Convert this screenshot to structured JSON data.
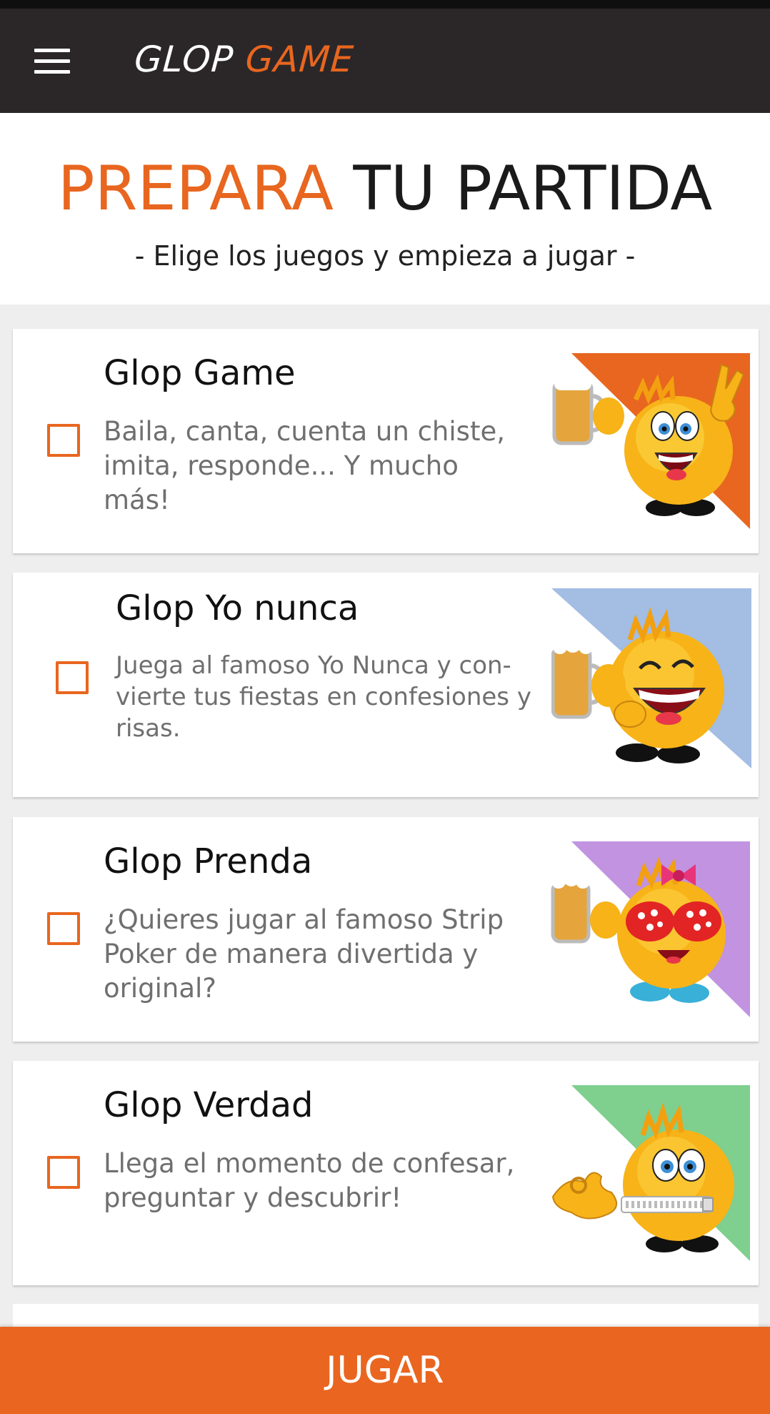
{
  "app": {
    "logo_part1": "GLOP",
    "logo_part2": "GAME",
    "brand_color": "#e8661f",
    "appbar_color": "#2b2729"
  },
  "header": {
    "title_accent": "PREPARA",
    "title_rest": "TU PARTIDA",
    "subtitle": "- Elige los juegos y empieza a jugar -"
  },
  "games": [
    {
      "title": "Glop Game",
      "description": "Baila, canta, cuenta un chiste, imita, responde... Y mucho más!",
      "checked": false,
      "image_color": "#e8661f",
      "mascot": "cheering-mascot-with-beer"
    },
    {
      "title": "Glop Yo nunca",
      "description": "Juega al famoso Yo Nunca y con-vierte tus fiestas en confesiones y risas.",
      "checked": false,
      "image_color": "#a3bde3",
      "mascot": "laughing-mascot-with-beer"
    },
    {
      "title": "Glop Prenda",
      "description": "¿Quieres jugar al famoso Strip Poker de manera divertida y original?",
      "checked": false,
      "image_color": "#c193e0",
      "mascot": "mascot-with-bow-and-bra"
    },
    {
      "title": "Glop Verdad",
      "description": "Llega el momento de confesar, preguntar y descubrir!",
      "checked": false,
      "image_color": "#7fcf8e",
      "mascot": "mascot-with-zipped-mouth"
    }
  ],
  "actions": {
    "play_label": "JUGAR"
  },
  "icons": {
    "menu": "hamburger-menu-icon",
    "checkbox": "checkbox-icon"
  }
}
